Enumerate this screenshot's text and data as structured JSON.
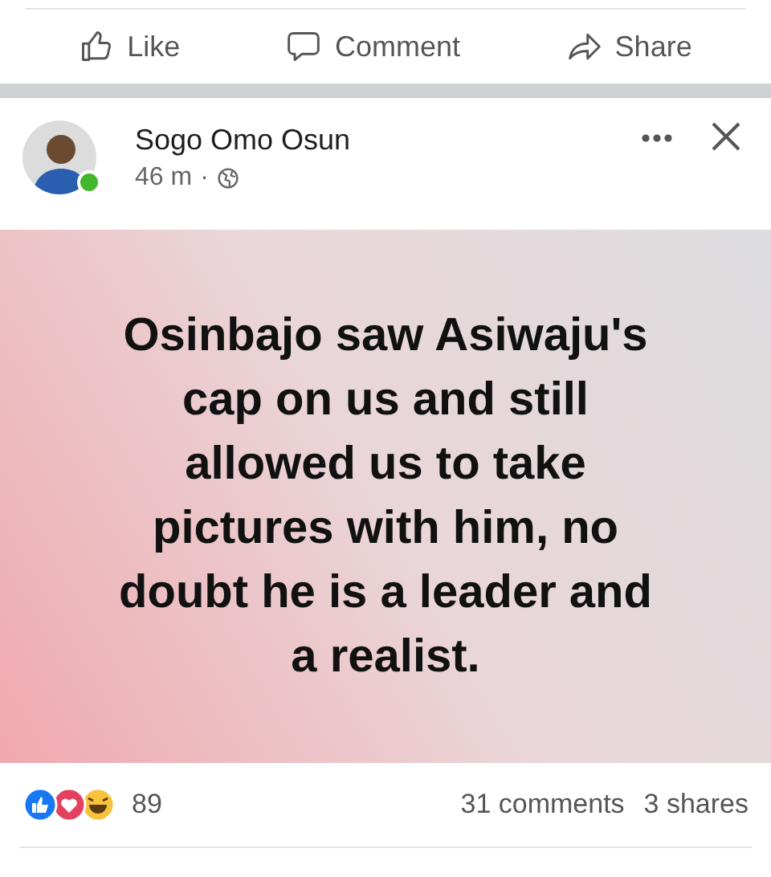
{
  "top_actions": [
    {
      "kind": "like",
      "label": "Like"
    },
    {
      "kind": "comment",
      "label": "Comment"
    },
    {
      "kind": "share",
      "label": "Share"
    }
  ],
  "post": {
    "author": "Sogo Omo Osun",
    "online": true,
    "time": "46 m",
    "separator": "·",
    "text": "Osinbajo saw Asiwaju's\ncap on us and still\nallowed us to take\npictures with him, no\ndoubt he is a leader and\na realist.",
    "reactions": [
      {
        "kind": "like"
      },
      {
        "kind": "love"
      },
      {
        "kind": "haha"
      }
    ],
    "reaction_count": "89",
    "comments": "31 comments",
    "shares": "3 shares"
  }
}
